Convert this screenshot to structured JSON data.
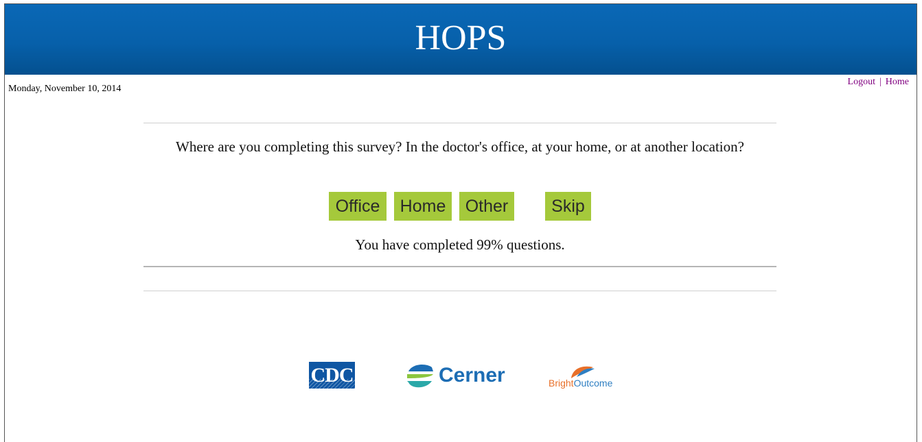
{
  "header": {
    "title": "HOPS"
  },
  "date": "Monday, November 10, 2014",
  "nav": {
    "logout": "Logout",
    "separator": "|",
    "home": "Home"
  },
  "question": {
    "text": "Where are you completing this survey? In the doctor's office, at your home, or at another location?"
  },
  "answers": {
    "office": "Office",
    "home": "Home",
    "other": "Other",
    "skip": "Skip"
  },
  "progress": {
    "text": "You have completed 99% questions.",
    "percent": 99
  },
  "logos": {
    "cdc": "CDC",
    "cerner": "Cerner",
    "brightoutcome_part1": "Bright",
    "brightoutcome_part2": "Outcome"
  },
  "colors": {
    "banner": "#0760aa",
    "button": "#a5c93b",
    "link": "#800080"
  }
}
